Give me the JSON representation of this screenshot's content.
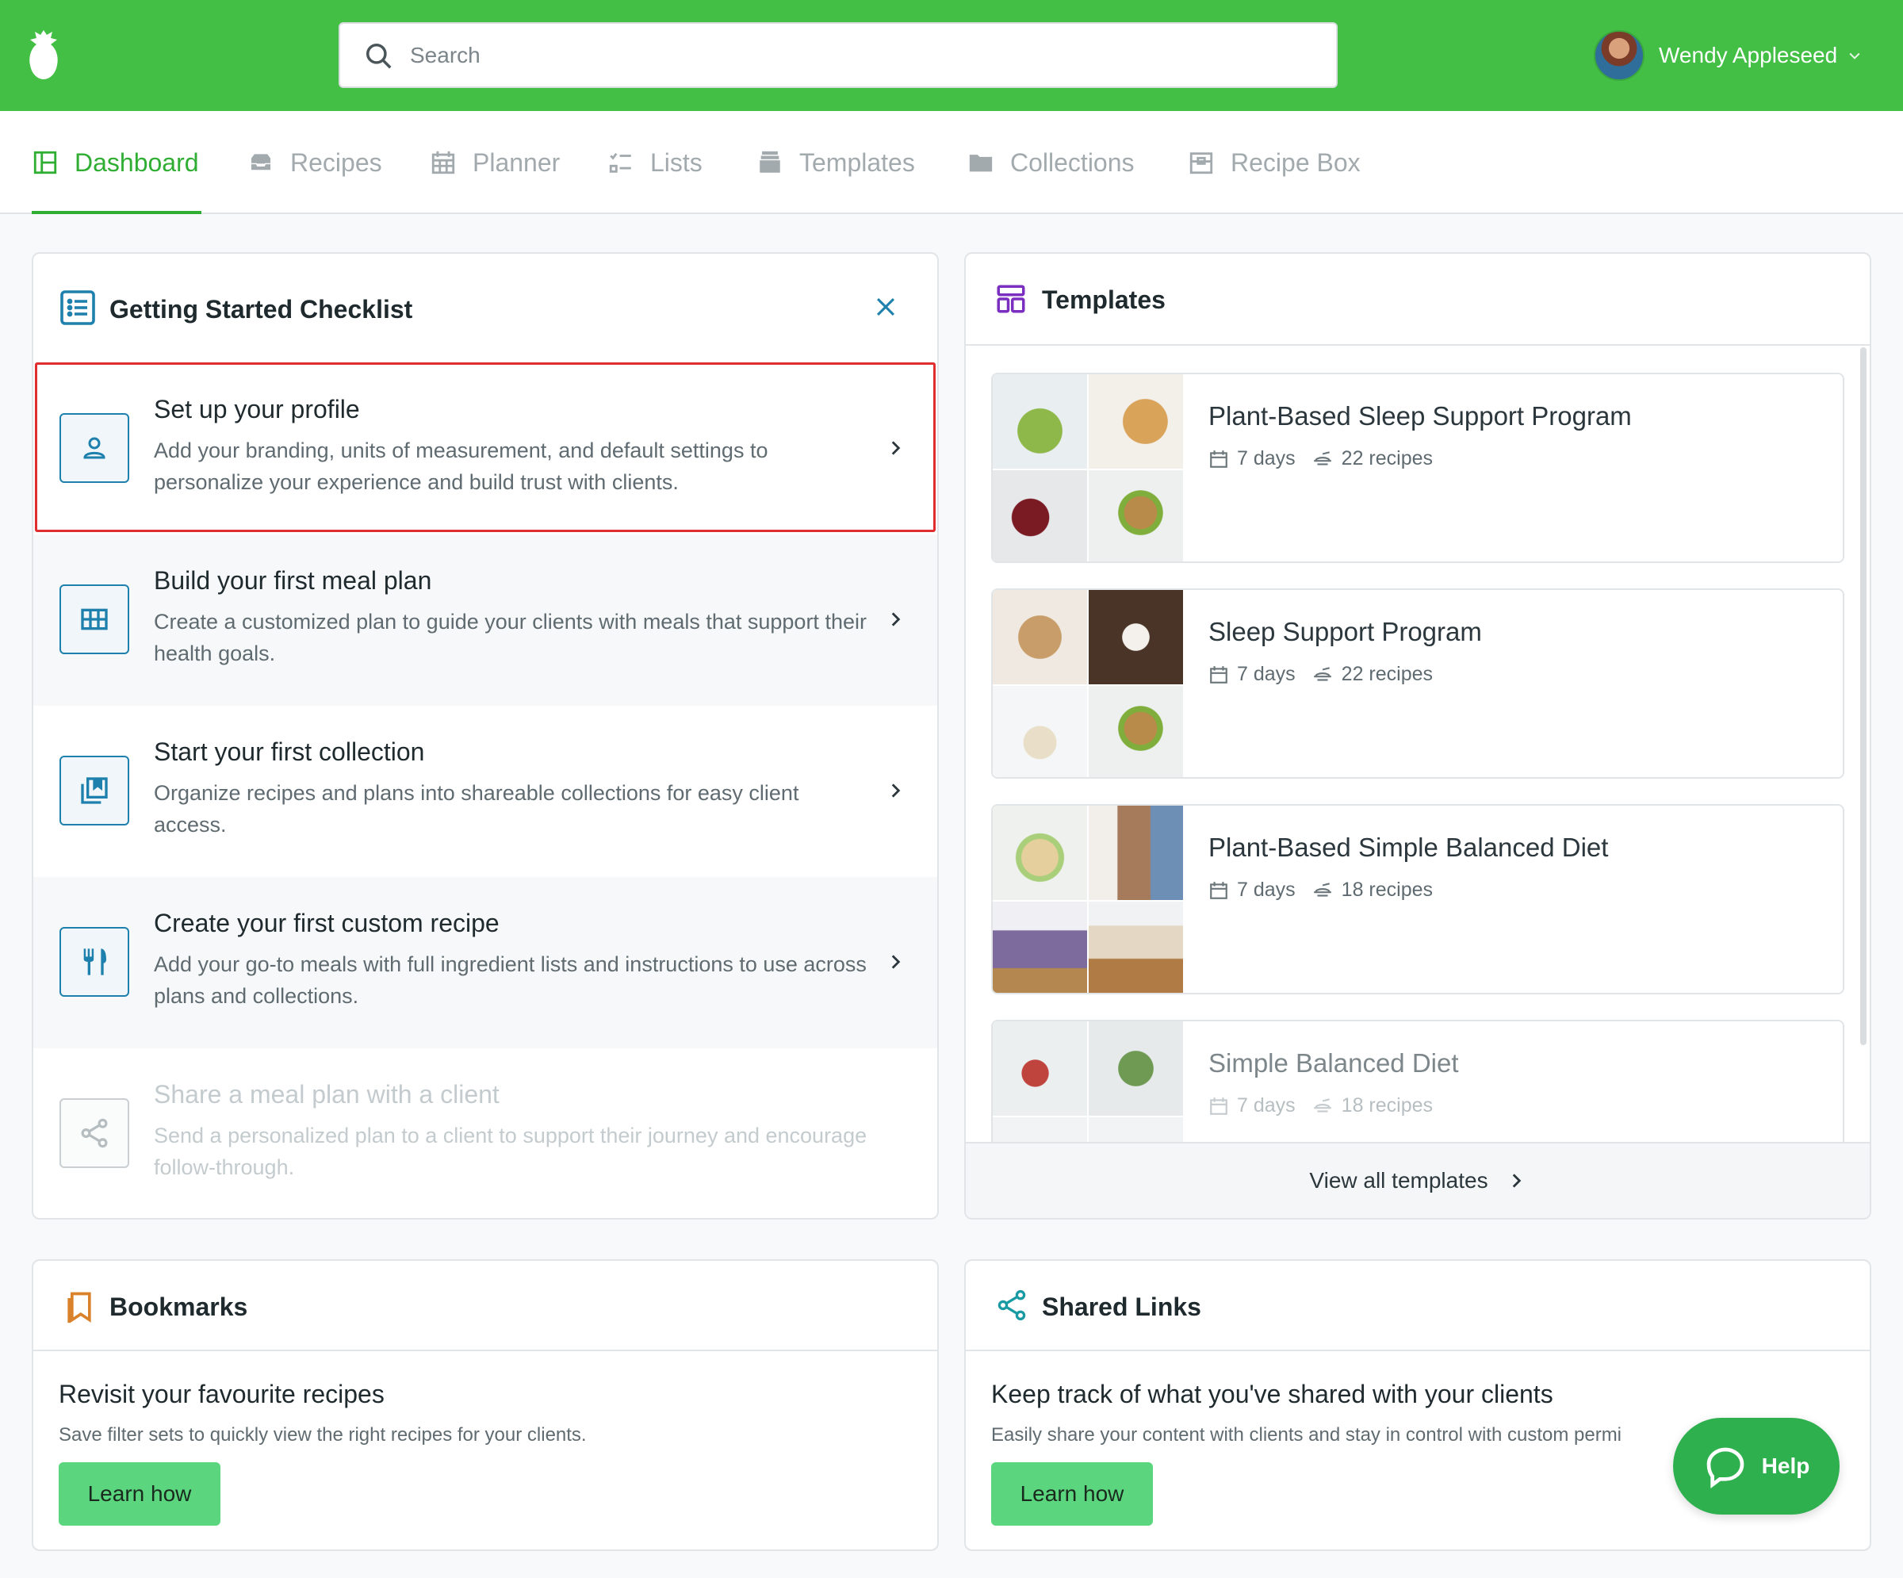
{
  "header": {
    "search_placeholder": "Search",
    "user_name": "Wendy Appleseed",
    "brand_color": "#43bf45"
  },
  "nav": {
    "items": [
      {
        "label": "Dashboard",
        "icon": "dashboard-icon",
        "active": true
      },
      {
        "label": "Recipes",
        "icon": "inbox-icon"
      },
      {
        "label": "Planner",
        "icon": "calendar-icon"
      },
      {
        "label": "Lists",
        "icon": "checklist-icon"
      },
      {
        "label": "Templates",
        "icon": "archive-icon"
      },
      {
        "label": "Collections",
        "icon": "folder-icon"
      },
      {
        "label": "Recipe Box",
        "icon": "box-icon"
      }
    ]
  },
  "checklist": {
    "title": "Getting Started Checklist",
    "items": [
      {
        "title": "Set up your profile",
        "desc": "Add your branding, units of measurement, and default settings to personalize your experience and build trust with clients.",
        "icon": "user-icon"
      },
      {
        "title": "Build your first meal plan",
        "desc": "Create a customized plan to guide your clients with meals that support their health goals.",
        "icon": "grid-icon"
      },
      {
        "title": "Start your first collection",
        "desc": "Organize recipes and plans into shareable collections for easy client access.",
        "icon": "collection-icon"
      },
      {
        "title": "Create your first custom recipe",
        "desc": "Add your go-to meals with full ingredient lists and instructions to use across plans and collections.",
        "icon": "utensils-icon"
      },
      {
        "title": "Share a meal plan with a client",
        "desc": "Send a personalized plan to a client to support their journey and encourage follow-through.",
        "icon": "share-icon",
        "disabled": true
      }
    ]
  },
  "templates": {
    "title": "Templates",
    "footer": "View all templates",
    "items": [
      {
        "name": "Plant-Based Sleep Support Program",
        "days": "7 days",
        "recipes": "22 recipes"
      },
      {
        "name": "Sleep Support Program",
        "days": "7 days",
        "recipes": "22 recipes"
      },
      {
        "name": "Plant-Based Simple Balanced Diet",
        "days": "7 days",
        "recipes": "18 recipes"
      },
      {
        "name": "Simple Balanced Diet",
        "days": "7 days",
        "recipes": "18 recipes"
      }
    ]
  },
  "bookmarks": {
    "title": "Bookmarks",
    "subtitle": "Revisit your favourite recipes",
    "desc": "Save filter sets to quickly view the right recipes for your clients.",
    "button": "Learn how"
  },
  "shared_links": {
    "title": "Shared Links",
    "subtitle": "Keep track of what you've shared with your clients",
    "desc": "Easily share your content with clients and stay in control with custom permi",
    "button": "Learn how"
  },
  "help": {
    "label": "Help"
  }
}
